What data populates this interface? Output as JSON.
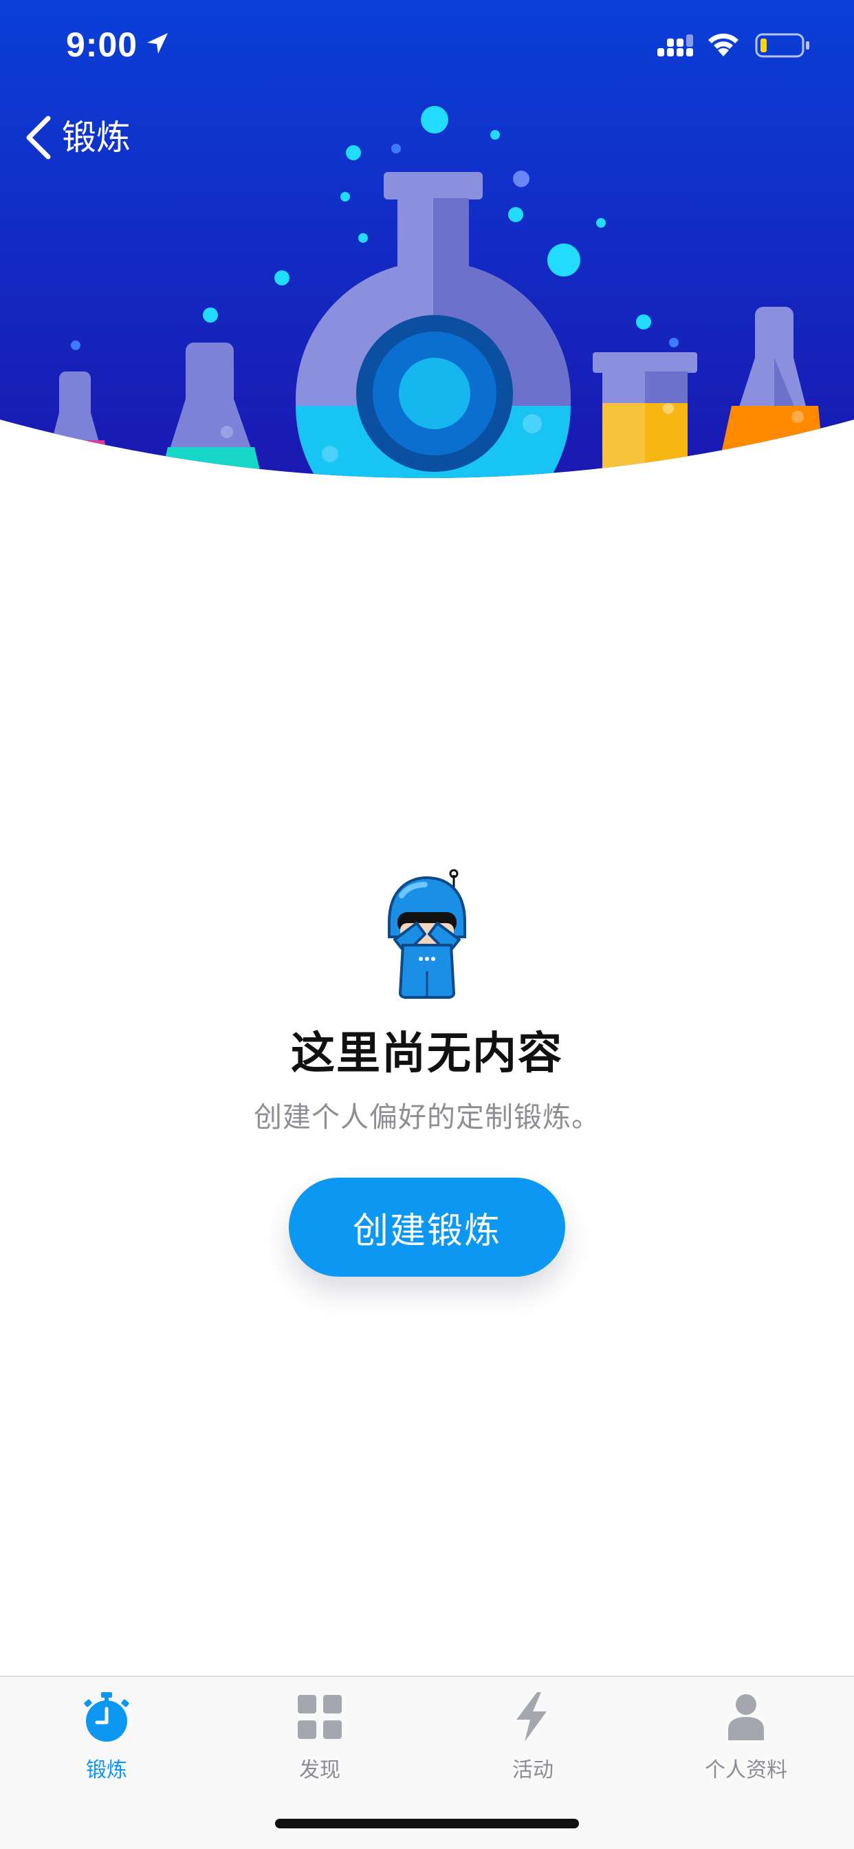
{
  "status_bar": {
    "time": "9:00",
    "location_icon": "location-arrow-icon",
    "signal_icon": "cellular-signal-icon",
    "wifi_icon": "wifi-icon",
    "battery_icon": "battery-low-icon",
    "battery_level": 0.12
  },
  "nav": {
    "back_icon": "chevron-left-icon",
    "back_label": "锻炼"
  },
  "hero": {
    "illustration": "lab-flasks-illustration",
    "colors": {
      "bg_top": "#0b38d6",
      "bg_bottom": "#1a1db5",
      "flask": "#7c82d8",
      "liquid_cyan": "#18c4f2",
      "liquid_yellow": "#f6b614",
      "liquid_orange": "#ff8a00",
      "liquid_teal": "#16d6c6",
      "bubble": "#22dcff"
    }
  },
  "empty_state": {
    "mascot_icon": "robot-mascot-icon",
    "title": "这里尚无内容",
    "subtitle": "创建个人偏好的定制锻炼。",
    "button_label": "创建锻炼"
  },
  "tabs": [
    {
      "label": "锻炼",
      "icon": "stopwatch-icon",
      "active": true
    },
    {
      "label": "发现",
      "icon": "grid-icon",
      "active": false
    },
    {
      "label": "活动",
      "icon": "lightning-icon",
      "active": false
    },
    {
      "label": "个人资料",
      "icon": "person-icon",
      "active": false
    }
  ],
  "colors": {
    "accent": "#0b97f2",
    "tab_inactive": "#8a8d93",
    "title": "#111111",
    "subtitle": "#8e8e93"
  }
}
